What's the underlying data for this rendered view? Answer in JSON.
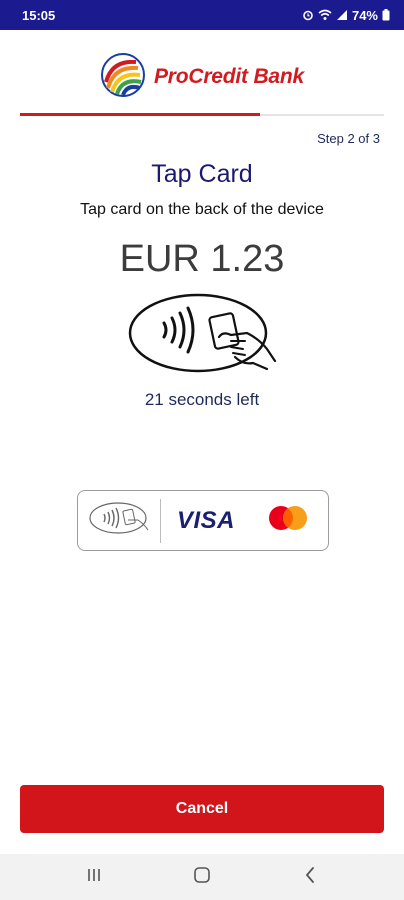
{
  "status_bar": {
    "time": "15:05",
    "battery": "74%",
    "icons": [
      "alarm-icon",
      "wifi-icon",
      "signal-icon",
      "battery-icon"
    ]
  },
  "header": {
    "bank_name": "ProCredit Bank"
  },
  "progress": {
    "fraction": 0.66,
    "step_text": "Step 2 of 3"
  },
  "main": {
    "title": "Tap Card",
    "subtitle": "Tap card on the back of the device",
    "amount": "EUR 1.23",
    "countdown": "21 seconds left"
  },
  "payment_methods": {
    "items": [
      "contactless-icon",
      "visa-logo",
      "mastercard-logo"
    ],
    "visa_text": "VISA"
  },
  "actions": {
    "cancel_label": "Cancel"
  },
  "colors": {
    "brand_red": "#d21a1f",
    "status_bar": "#1b1a8f",
    "title": "#1b1a6e"
  }
}
